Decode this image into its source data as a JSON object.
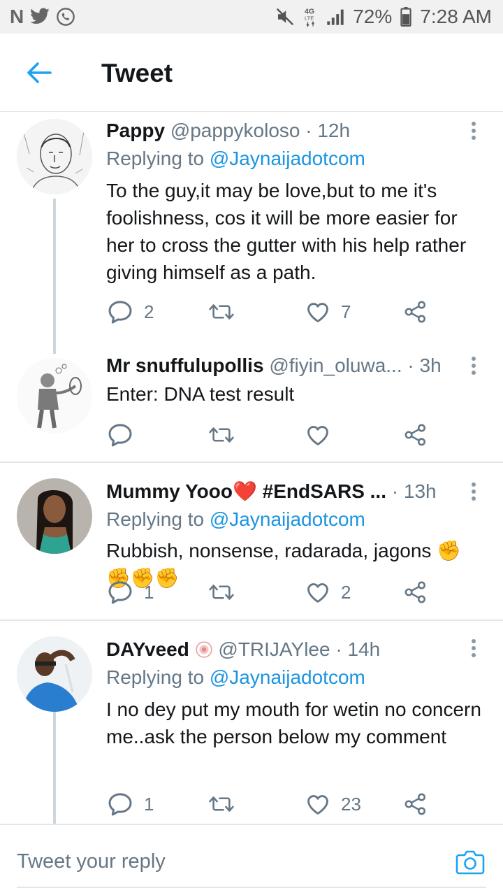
{
  "status_bar": {
    "left_icons": [
      "N",
      "twitter-bird",
      "whatsapp"
    ],
    "battery": "72%",
    "time": "7:28 AM",
    "network": "4G LTE"
  },
  "header": {
    "title": "Tweet"
  },
  "tweets": [
    {
      "name": "Pappy",
      "handle": "@pappykoloso",
      "time": "12h",
      "replying_prefix": "Replying to",
      "replying_to": "@Jaynaijadotcom",
      "text": "To the guy,it may be love,but to me it's foolishness, cos it will be more easier for her to cross the gutter with his help rather giving himself as a path.",
      "reply_count": "2",
      "retweet_count": "",
      "like_count": "7"
    },
    {
      "name": "Mr snuffulupollis",
      "handle": "@fiyin_oluwa...",
      "time": "3h",
      "text": "Enter: DNA test result",
      "reply_count": "",
      "retweet_count": "",
      "like_count": ""
    },
    {
      "name": "Mummy Yooo❤️ #EndSARS ...",
      "handle": "",
      "time": "13h",
      "replying_prefix": "Replying to",
      "replying_to": "@Jaynaijadotcom",
      "text": "Rubbish, nonsense, radarada, jagons ✊✊✊✊",
      "reply_count": "1",
      "retweet_count": "",
      "like_count": "2"
    },
    {
      "name": "DAYveed",
      "handle": "@TRIJAYlee",
      "time": "14h",
      "replying_prefix": "Replying to",
      "replying_to": "@Jaynaijadotcom",
      "text": "I no dey put my mouth for wetin no concern me..ask the person below my comment",
      "reply_count": "1",
      "retweet_count": "",
      "like_count": "23"
    }
  ],
  "compose": {
    "placeholder": "Tweet your reply"
  },
  "colors": {
    "accent": "#1da1f2",
    "mention": "#1b95e0",
    "secondary_text": "#657786",
    "divider": "#e1e8ed"
  }
}
